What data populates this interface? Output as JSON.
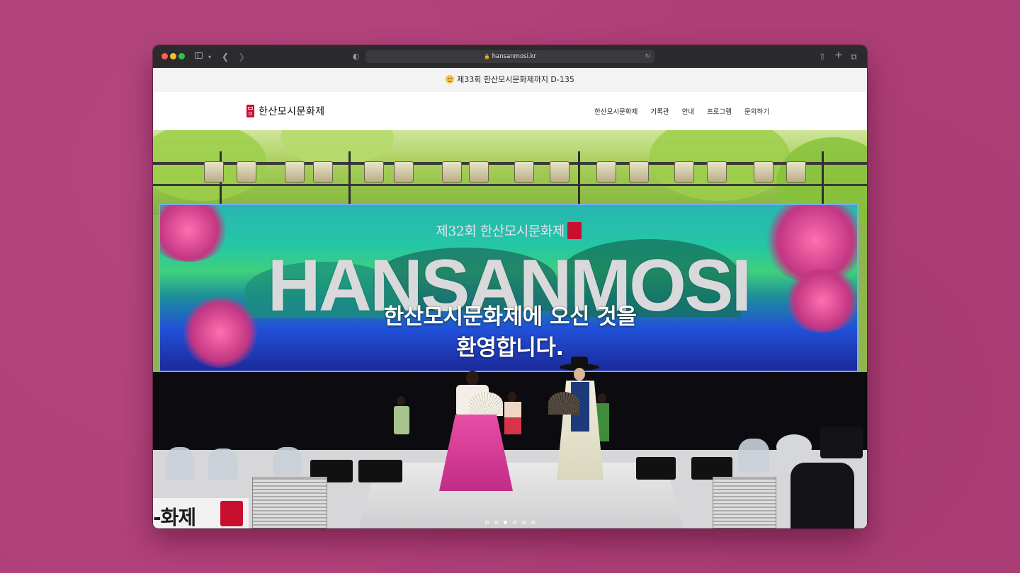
{
  "browser": {
    "url": "hansanmosi.kr",
    "lock_icon": "lock-icon",
    "reload_icon": "reload-icon"
  },
  "announcement": {
    "text": "제33회 한산모시문화제까지 D-135",
    "emoji": "smiling-face-icon"
  },
  "header": {
    "logo_text": "한산모시문화제",
    "nav": [
      "한산모시문화제",
      "기록관",
      "안내",
      "프로그램",
      "문의하기"
    ]
  },
  "hero": {
    "banner_title": "제32회 한산모시문화제",
    "banner_wordmark": "HANSANMOSI",
    "headline_line1": "한산모시문화제에 오신 것을",
    "headline_line2": "환영합니다.",
    "sign_text": "-화제",
    "slides_total": 6,
    "slide_active": 3
  },
  "colors": {
    "page_background": "#b03f79",
    "brand_red": "#c8102e"
  }
}
